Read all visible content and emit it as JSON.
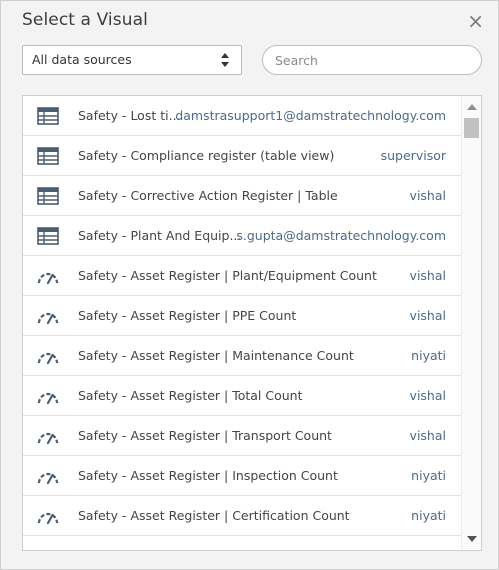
{
  "dialog": {
    "title": "Select a Visual",
    "close_label": "×"
  },
  "filters": {
    "source_selected": "All data sources",
    "search_placeholder": "Search"
  },
  "visuals": [
    {
      "icon": "table-icon",
      "name": "Safety - Lost ti...",
      "owner": "damstrasupport1@damstratechnology.com"
    },
    {
      "icon": "table-icon",
      "name": "Safety - Compliance register (table view)",
      "owner": "supervisor"
    },
    {
      "icon": "table-icon",
      "name": "Safety - Corrective Action Register | Table",
      "owner": "vishal"
    },
    {
      "icon": "table-icon",
      "name": "Safety - Plant And Equip...",
      "owner": "s.gupta@damstratechnology.com"
    },
    {
      "icon": "gauge-icon",
      "name": "Safety - Asset Register | Plant/Equipment Count",
      "owner": "vishal"
    },
    {
      "icon": "gauge-icon",
      "name": "Safety - Asset Register | PPE Count",
      "owner": "vishal"
    },
    {
      "icon": "gauge-icon",
      "name": "Safety - Asset Register | Maintenance Count",
      "owner": "niyati"
    },
    {
      "icon": "gauge-icon",
      "name": "Safety - Asset Register | Total Count",
      "owner": "vishal"
    },
    {
      "icon": "gauge-icon",
      "name": "Safety - Asset Register | Transport Count",
      "owner": "vishal"
    },
    {
      "icon": "gauge-icon",
      "name": "Safety - Asset Register | Inspection Count",
      "owner": "niyati"
    },
    {
      "icon": "gauge-icon",
      "name": "Safety - Asset Register | Certification Count",
      "owner": "niyati"
    },
    {
      "icon": "gauge-icon",
      "name": "",
      "owner": ""
    }
  ],
  "colors": {
    "owner_text": "#4a6b8a",
    "icon": "#4b5d70"
  }
}
